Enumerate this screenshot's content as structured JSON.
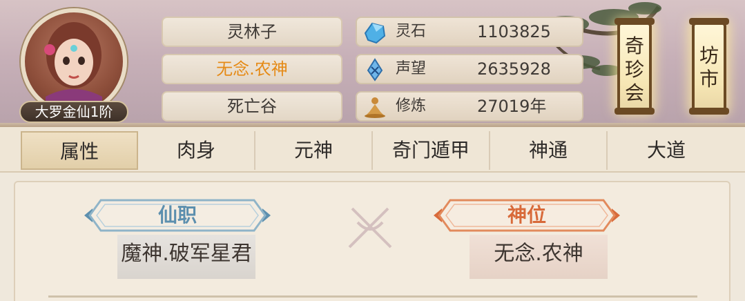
{
  "player": {
    "rank": "大罗金仙1阶",
    "name": "灵林子",
    "title": "无念.农神",
    "location": "死亡谷"
  },
  "resources": [
    {
      "icon": "spirit-stone-icon",
      "label": "灵石",
      "value": "1103825"
    },
    {
      "icon": "reputation-crystal-icon",
      "label": "声望",
      "value": "2635928"
    },
    {
      "icon": "meditation-icon",
      "label": "修炼",
      "value": "27019年"
    }
  ],
  "lanterns": [
    {
      "chars": [
        "奇",
        "珍",
        "会"
      ]
    },
    {
      "chars": [
        "坊",
        "市"
      ]
    }
  ],
  "tabs": [
    "属性",
    "肉身",
    "元神",
    "奇门遁甲",
    "神通",
    "大道"
  ],
  "active_tab": 0,
  "panels": {
    "left": {
      "heading": "仙职",
      "value": "魔神.破军星君"
    },
    "right": {
      "heading": "神位",
      "value": "无念.农神"
    }
  },
  "colors": {
    "title_orange": "#e58a16",
    "left_heading": "#5c8fae",
    "right_heading": "#d86a3a"
  }
}
